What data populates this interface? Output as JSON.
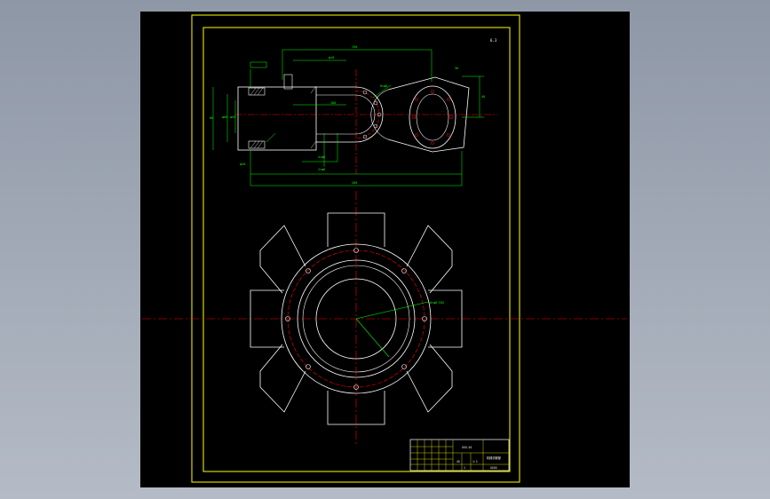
{
  "drawing": {
    "colors": {
      "background": "#000000",
      "frame": "#ffff00",
      "outline": "#ffffff",
      "dimension": "#00ff00",
      "centerline": "#ff0000"
    },
    "roughness_note": "6.3",
    "dimensions": {
      "top_overall": "190",
      "top_pin": "φ10",
      "top_right": "30",
      "left_height": "80",
      "left_inner_1": "φ60",
      "left_inner_2": "φ45",
      "mid_slot": "100",
      "right_height": "40",
      "bottom_lower": "φ20",
      "bottom_total": "200",
      "holes_top": "8×φ8",
      "holes_mid": "4×φ6",
      "holes_bottom": "2×φ6"
    },
    "circle_callout": "8×φ8\nEQS",
    "title_block": {
      "drawing_no": "XXX-01",
      "part_name": "机械手腕部",
      "material": "45",
      "school": "XXXX",
      "scale": "1:1",
      "sheet": "1"
    }
  }
}
